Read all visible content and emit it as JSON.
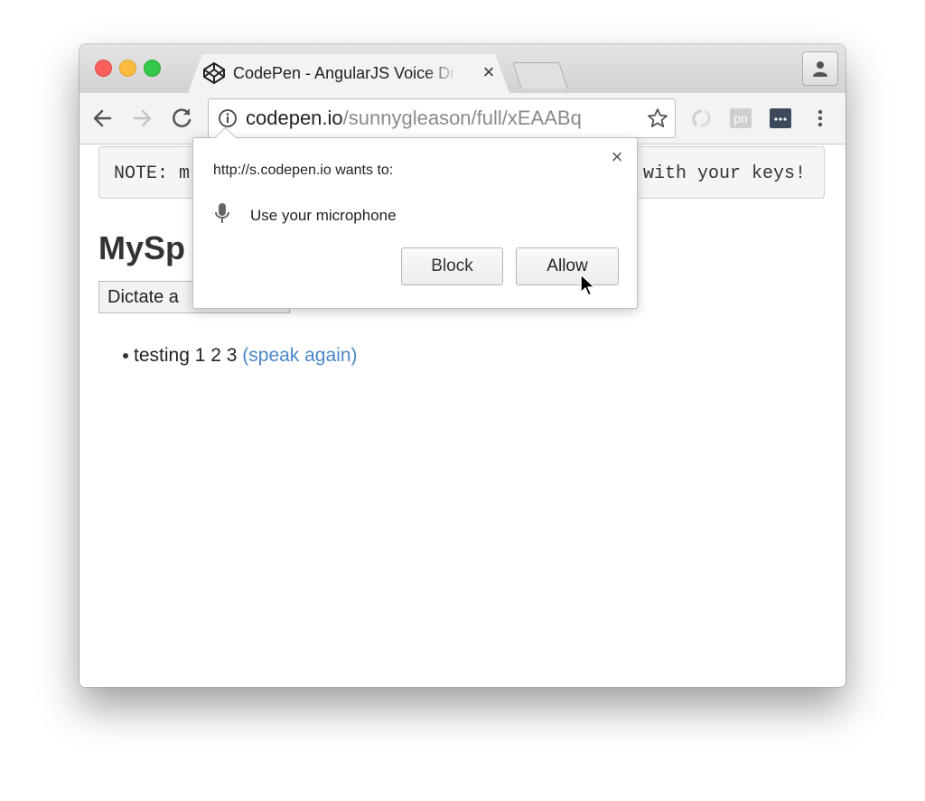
{
  "browser": {
    "tab": {
      "title": "CodePen - AngularJS Voice Di",
      "close_glyph": "×",
      "favicon": "codepen-logo-icon"
    },
    "address_bar": {
      "domain": "codepen.io",
      "path": "/sunnygleason/full/xEAABq"
    },
    "extensions": [
      "extension-icon",
      "pn-extension-icon",
      "more-extension-icon"
    ],
    "colors": {
      "close": "#fc605c",
      "minimize": "#fdbc40",
      "zoom": "#34c84a",
      "link": "#4a86c7"
    }
  },
  "page": {
    "note_left": "NOTE: m",
    "note_right": "with your keys!",
    "heading": "MySp",
    "dictate_button": "Dictate a",
    "results": [
      {
        "text": "testing 1 2 3",
        "link": "(speak again)"
      }
    ]
  },
  "permission_popup": {
    "origin_text": "http://s.codepen.io wants to:",
    "permission": "Use your microphone",
    "block_label": "Block",
    "allow_label": "Allow",
    "close_glyph": "×"
  }
}
